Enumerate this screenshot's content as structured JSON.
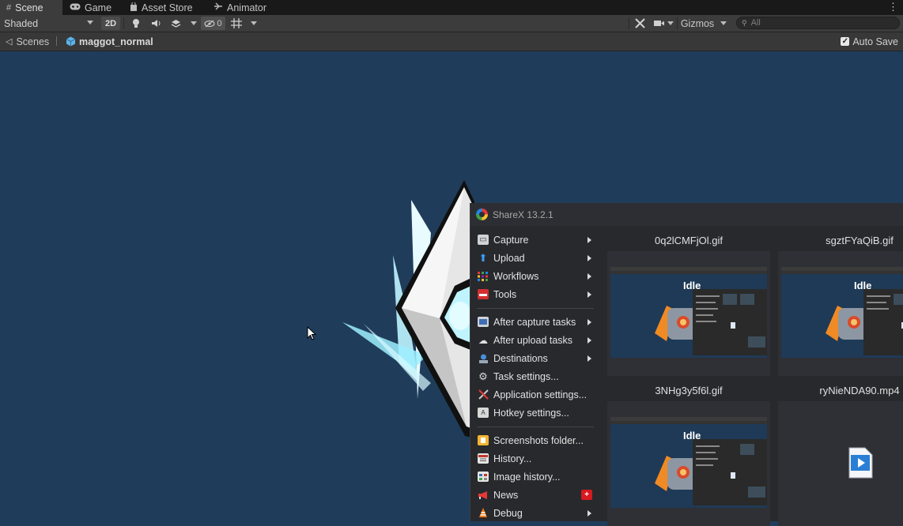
{
  "tabs": [
    {
      "label": "Scene",
      "icon": "hash-icon"
    },
    {
      "label": "Game",
      "icon": "gamepad-icon"
    },
    {
      "label": "Asset Store",
      "icon": "store-icon"
    },
    {
      "label": "Animator",
      "icon": "animator-icon"
    }
  ],
  "toolbar": {
    "draw_mode": "Shaded",
    "btn_2d": "2D",
    "hidden_count": "0",
    "gizmos": "Gizmos",
    "search_placeholder": "All"
  },
  "breadcrumb": {
    "root": "Scenes",
    "scene": "maggot_normal",
    "auto_save": "Auto Save",
    "auto_save_checked": true
  },
  "sharex": {
    "title": "ShareX 13.2.1",
    "menu": [
      {
        "label": "Capture",
        "icon": "capture-icon",
        "submenu": true
      },
      {
        "label": "Upload",
        "icon": "upload-icon",
        "submenu": true
      },
      {
        "label": "Workflows",
        "icon": "workflows-icon",
        "submenu": true
      },
      {
        "label": "Tools",
        "icon": "tools-icon",
        "submenu": true
      },
      {
        "label": "After capture tasks",
        "icon": "after-capture-icon",
        "submenu": true
      },
      {
        "label": "After upload tasks",
        "icon": "after-upload-icon",
        "submenu": true
      },
      {
        "label": "Destinations",
        "icon": "destinations-icon",
        "submenu": true
      },
      {
        "label": "Task settings...",
        "icon": "gear-icon",
        "submenu": false
      },
      {
        "label": "Application settings...",
        "icon": "wrench-icon",
        "submenu": false
      },
      {
        "label": "Hotkey settings...",
        "icon": "keyboard-icon",
        "submenu": false
      },
      {
        "label": "Screenshots folder...",
        "icon": "folder-icon",
        "submenu": false
      },
      {
        "label": "History...",
        "icon": "history-icon",
        "submenu": false
      },
      {
        "label": "Image history...",
        "icon": "image-history-icon",
        "submenu": false
      },
      {
        "label": "News",
        "icon": "megaphone-icon",
        "badge": "+"
      },
      {
        "label": "Debug",
        "icon": "debug-icon",
        "submenu": true
      }
    ],
    "thumbnails": [
      {
        "name": "0q2lCMFjOl.gif",
        "preview_text": "Idle"
      },
      {
        "name": "sgztFYaQiB.gif",
        "preview_text": "Idle"
      },
      {
        "name": "3NHg3y5f6l.gif",
        "preview_text": "Idle"
      },
      {
        "name": "ryNieNDA90.mp4",
        "preview_text": ""
      }
    ]
  }
}
